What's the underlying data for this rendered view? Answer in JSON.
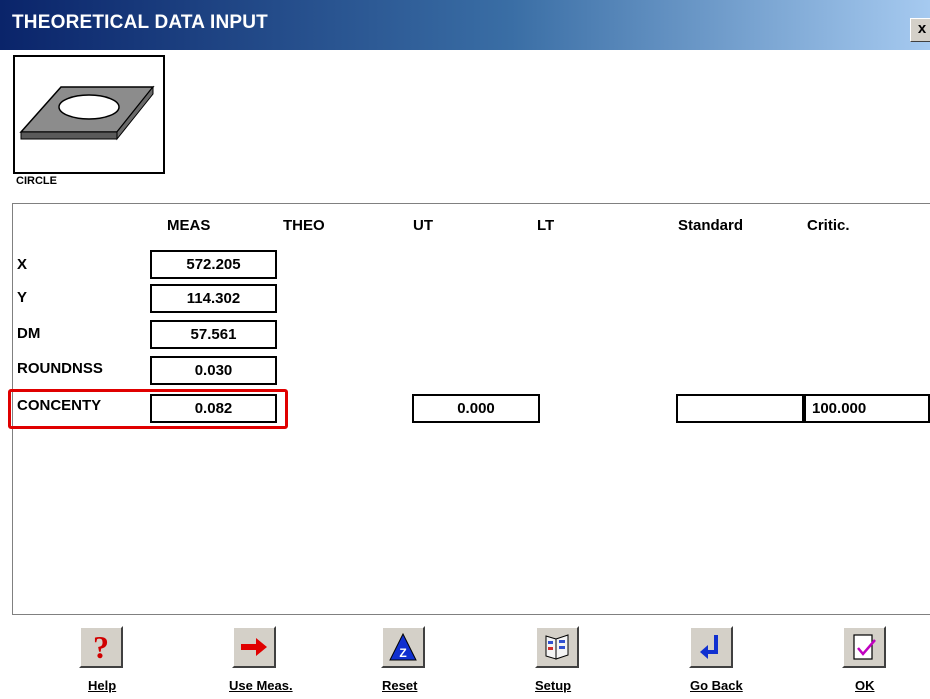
{
  "window": {
    "title": "THEORETICAL DATA INPUT",
    "close_glyph": "x"
  },
  "feature": {
    "label": "CIRCLE",
    "icon": "circle-plate-icon"
  },
  "columns": [
    "MEAS",
    "THEO",
    "UT",
    "LT",
    "Standard",
    "Critic."
  ],
  "rows": [
    {
      "label": "X",
      "meas": "572.205"
    },
    {
      "label": "Y",
      "meas": "114.302"
    },
    {
      "label": "DM",
      "meas": "57.561"
    },
    {
      "label": "ROUNDNSS",
      "meas": "0.030"
    },
    {
      "label": "CONCENTY",
      "meas": "0.082",
      "ut": "0.000",
      "standard": "",
      "critic": "100.000"
    }
  ],
  "buttons": [
    {
      "label": "Help",
      "icon": "question-icon"
    },
    {
      "label": "Use Meas.",
      "icon": "arrow-right-icon"
    },
    {
      "label": "Reset",
      "icon": "reset-icon"
    },
    {
      "label": "Setup",
      "icon": "setup-icon"
    },
    {
      "label": "Go Back",
      "icon": "go-back-icon"
    },
    {
      "label": "OK",
      "icon": "ok-check-icon"
    }
  ],
  "colors": {
    "highlight": "#e00000",
    "titlebar_start": "#0a246a"
  }
}
